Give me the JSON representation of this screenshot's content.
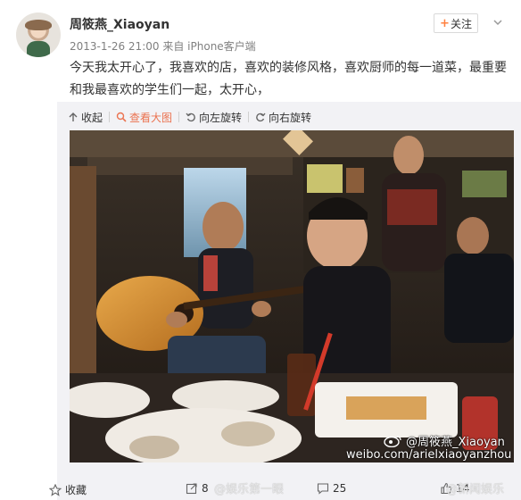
{
  "post": {
    "author": "周筱燕_Xiaoyan",
    "follow_label": "关注",
    "timestamp": "2013-1-26 21:00",
    "source_prefix": "来自",
    "source": "iPhone客户端",
    "text": "今天我太开心了，我喜欢的店，喜欢的装修风格，喜欢厨师的每一道菜，最重要和我最喜欢的学生们一起，太开心，"
  },
  "toolbar": {
    "items": [
      {
        "label": "收起",
        "icon": "arrow-up-icon"
      },
      {
        "label": "查看大图",
        "icon": "magnify-icon"
      },
      {
        "label": "向左旋转",
        "icon": "rotate-left-icon"
      },
      {
        "label": "向右旋转",
        "icon": "rotate-right-icon"
      }
    ]
  },
  "photo": {
    "watermark_handle": "@周筱燕_Xiaoyan",
    "watermark_url": "weibo.com/arielxiaoyanzhou"
  },
  "actions": {
    "favorite_label": "收藏",
    "repost_count": "8",
    "comment_count": "25",
    "like_count": "14"
  },
  "overlays": {
    "left_watermark": "@娱乐第一眼",
    "right_watermark": "@新闻娱乐"
  },
  "colors": {
    "accent": "#eb7350",
    "follow_plus": "#ff8140",
    "meta_gray": "#808080",
    "media_bg": "#f2f2f5"
  }
}
